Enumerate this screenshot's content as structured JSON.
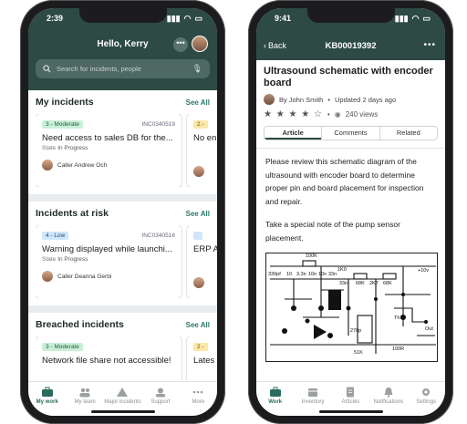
{
  "left": {
    "status": {
      "time": "2:39"
    },
    "header": {
      "greeting": "Hello, Kerry",
      "more": "•••",
      "search_placeholder": "Search for incidents, people"
    },
    "sections": [
      {
        "title": "My incidents",
        "see_all": "See All",
        "card": {
          "priority": "3 - Moderate",
          "number": "INC0340519",
          "title": "Need access to sales DB for the...",
          "state_label": "State",
          "state": "In Progress",
          "caller": "Caller Andrew Och"
        },
        "partial": {
          "priority": "2 -",
          "title": "No en"
        }
      },
      {
        "title": "Incidents at risk",
        "see_all": "See All",
        "card": {
          "priority": "4 - Low",
          "number": "INC0340516",
          "title": "Warning displayed while launchi...",
          "state_label": "State",
          "state": "In Progress",
          "caller": "Caller Deanna Gerbi"
        },
        "partial": {
          "title": "ERP A"
        }
      },
      {
        "title": "Breached incidents",
        "see_all": "See All",
        "card": {
          "priority": "3 - Moderate",
          "title": "Network file share not accessible!"
        },
        "partial": {
          "priority": "2 -",
          "title": "Lates"
        }
      }
    ],
    "tabs": [
      "My work",
      "My team",
      "Major incidents",
      "Support",
      "More"
    ]
  },
  "right": {
    "status": {
      "time": "9:41"
    },
    "header": {
      "back": "Back",
      "title": "KB00019392",
      "more": "•••"
    },
    "article": {
      "title": "Ultrasound schematic with encoder board",
      "author": "By John Smith",
      "updated": "Updated 2 days ago",
      "stars": "★ ★ ★ ★ ☆",
      "views": "240 views",
      "segments": [
        "Article",
        "Comments",
        "Related"
      ],
      "para1": "Please review this schematic diagram of the ultrasound with encoder board to determine proper pin and board placement for inspection and repair.",
      "para2": "Take a special note of the pump sensor placement.",
      "schematic_labels": [
        "100K",
        "1K0",
        "330pf",
        "10",
        "3.3n",
        "10n",
        "10n",
        "33n",
        "33n",
        "68K",
        "2K7",
        "68K",
        "+10v",
        "270p",
        "Th1",
        "Out",
        "100R",
        "51K"
      ]
    },
    "tabs": [
      "Work",
      "Inventory",
      "Articles",
      "Notifications",
      "Settings"
    ]
  },
  "colors": {
    "header": "#2d4a45",
    "accent": "#2a7a6a"
  }
}
